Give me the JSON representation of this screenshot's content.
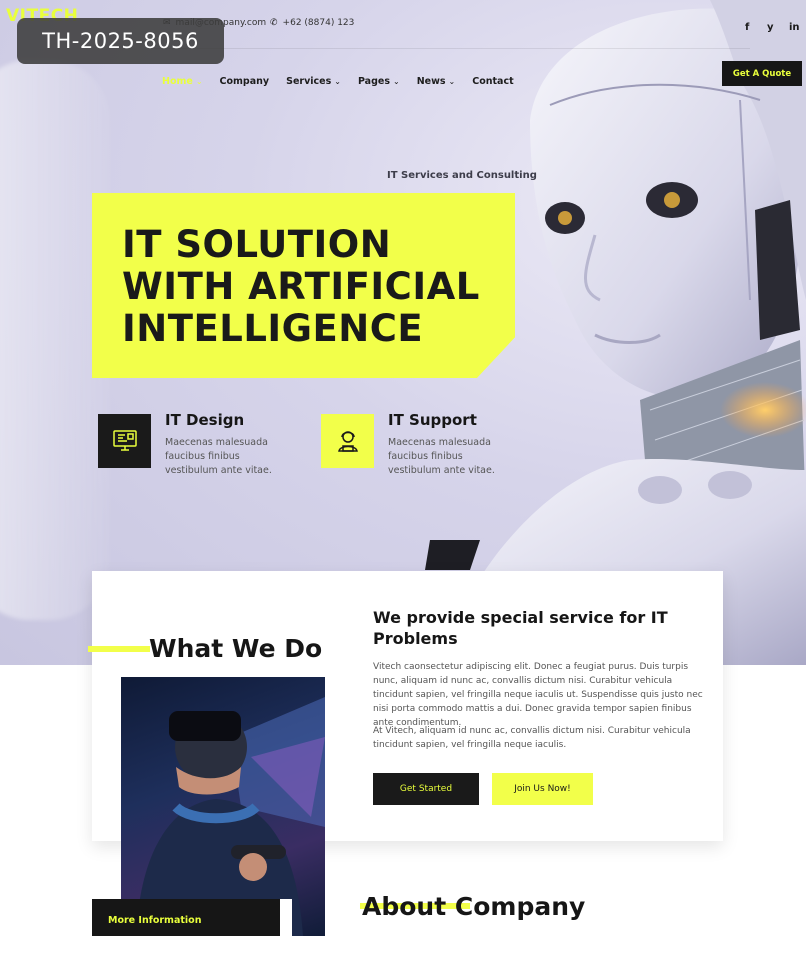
{
  "brand": {
    "logo": "VITECH",
    "accent": "#f2ff4a",
    "dark": "#161616"
  },
  "watermark": "TH-2025-8056",
  "topbar": {
    "email": "mail@company.com",
    "phone": "+62 (8874) 123",
    "social": [
      "f",
      "y",
      "in"
    ]
  },
  "nav": {
    "items": [
      {
        "label": "Home",
        "dropdown": true,
        "active": true
      },
      {
        "label": "Company",
        "dropdown": false
      },
      {
        "label": "Services",
        "dropdown": true
      },
      {
        "label": "Pages",
        "dropdown": true
      },
      {
        "label": "News",
        "dropdown": true
      },
      {
        "label": "Contact",
        "dropdown": false
      }
    ],
    "cta": "Get A Quote"
  },
  "hero": {
    "kicker": "IT Services and Consulting",
    "title_lines": [
      "IT SOLUTION",
      "WITH ARTIFICIAL",
      "INTELLIGENCE"
    ]
  },
  "features": [
    {
      "title": "IT Design",
      "icon": "monitor-design-icon",
      "text": "Maecenas malesuada faucibus finibus vestibulum ante vitae."
    },
    {
      "title": "IT Support",
      "icon": "support-agent-icon",
      "text": "Maecenas malesuada faucibus finibus vestibulum ante vitae."
    }
  ],
  "what_we_do": {
    "heading": "What We Do",
    "more": "More Information",
    "title": "We provide special service for IT Problems",
    "p1": "Vitech caonsectetur adipiscing elit. Donec a feugiat purus. Duis turpis nunc, aliquam id nunc ac, convallis dictum nisi. Curabitur vehicula tincidunt sapien, vel fringilla neque iaculis ut. Suspendisse quis justo nec nisi porta commodo mattis a dui. Donec gravida tempor sapien finibus ante condimentum.",
    "p2": "At Vitech, aliquam id nunc ac, convallis dictum nisi. Curabitur vehicula tincidunt sapien, vel fringilla neque iaculis.",
    "btn_primary": "Get Started",
    "btn_secondary": "Join Us Now!"
  },
  "about": {
    "heading": "About Company"
  }
}
